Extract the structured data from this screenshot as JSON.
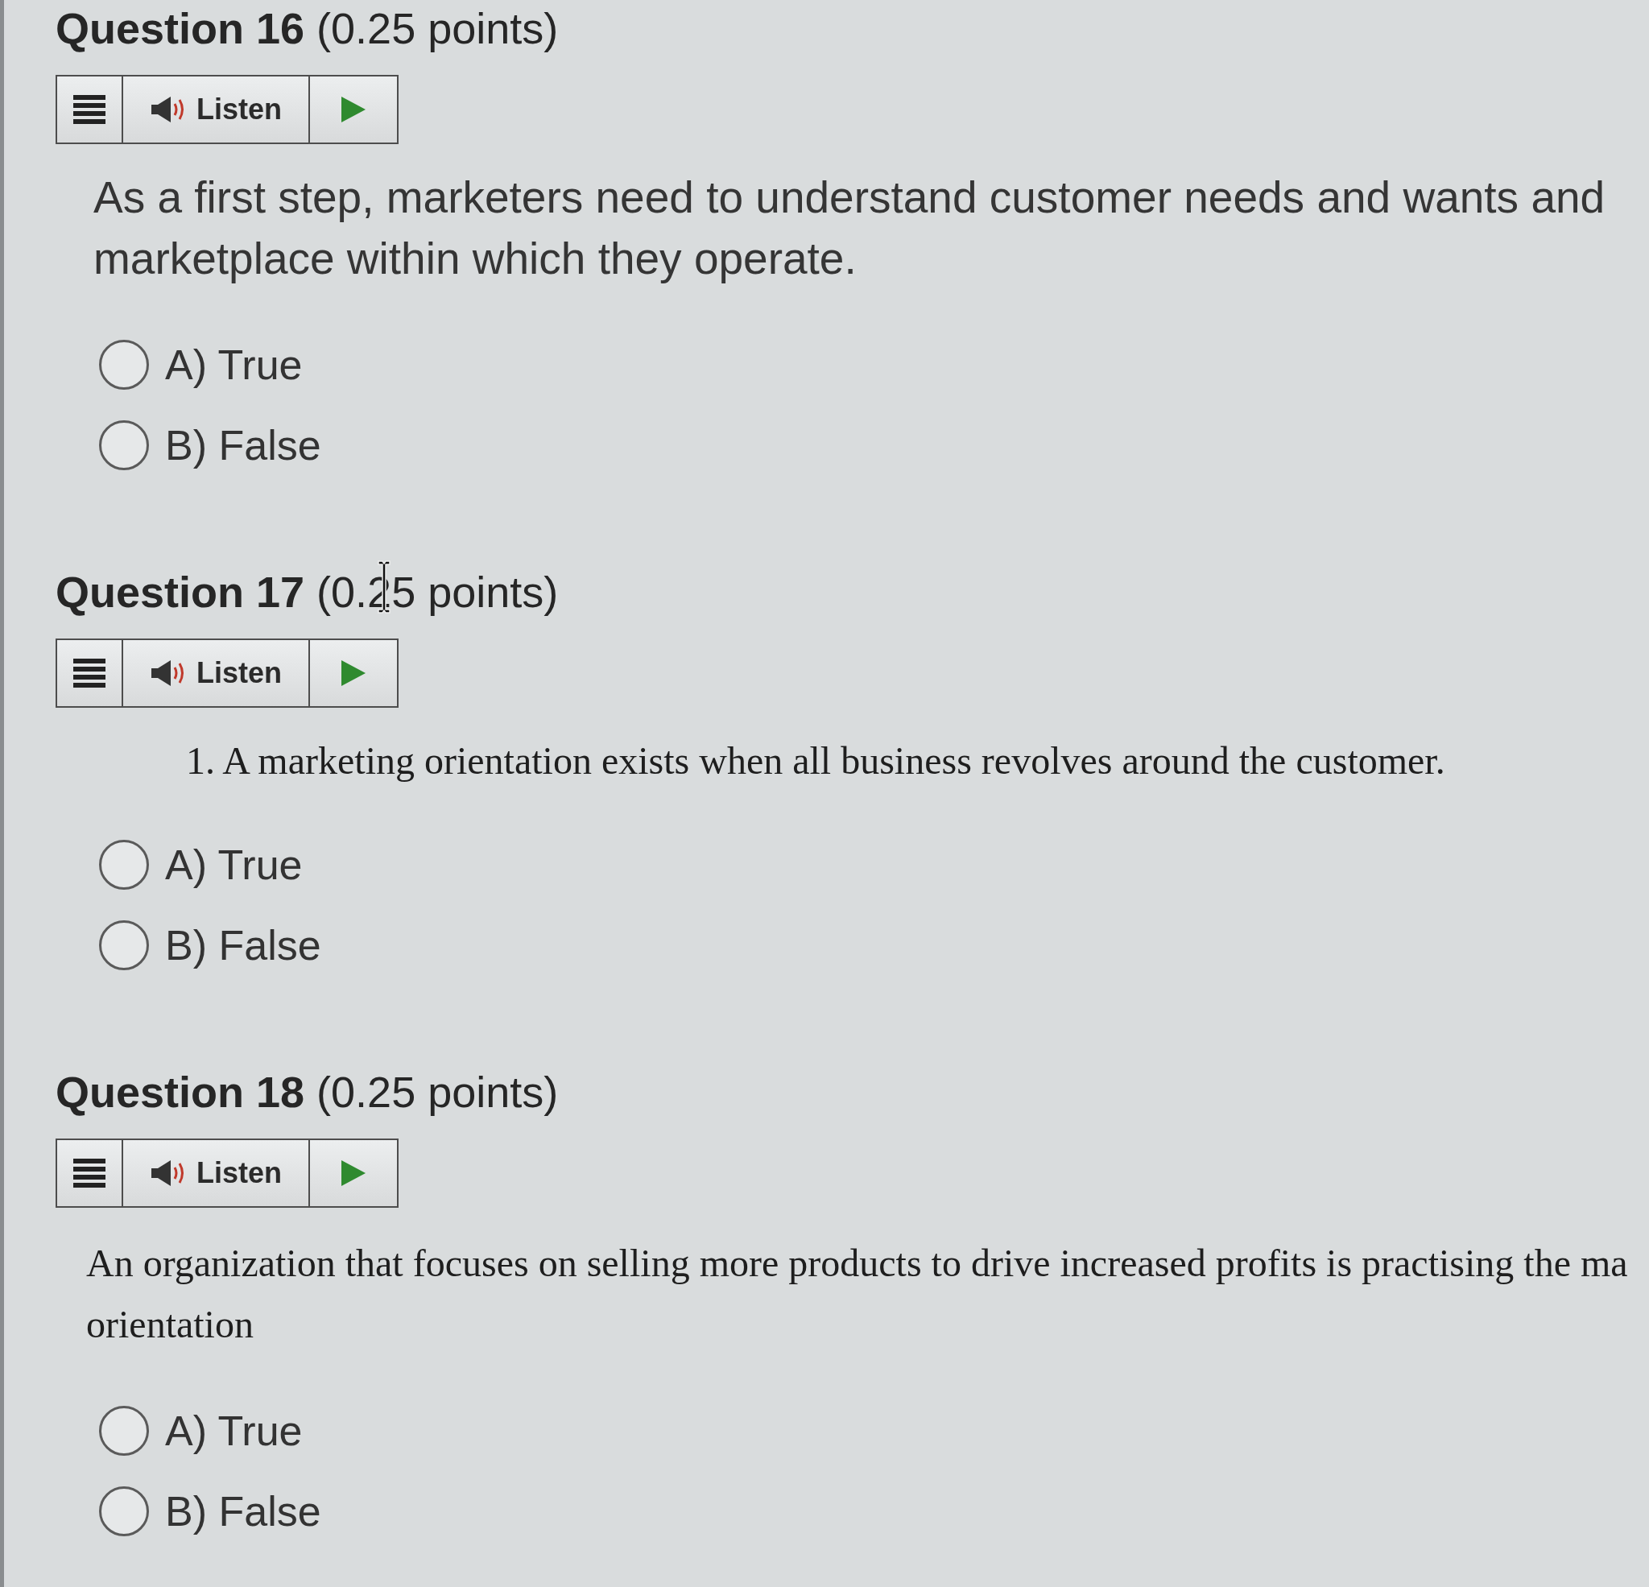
{
  "questions": [
    {
      "title": "**Question 16** (0.25 points)",
      "toolbar": {
        "listen": "Listen"
      },
      "prompt": {
        "kind": "sans",
        "lines": [
          "As a first step, marketers need to understand customer needs and wants and",
          "marketplace within which they operate."
        ]
      },
      "options": [
        {
          "label": "A) True",
          "selected": false
        },
        {
          "label": "B) False",
          "selected": false
        }
      ]
    },
    {
      "title": "**Question 17** (0.25 points)",
      "text_cursor": true,
      "toolbar": {
        "listen": "Listen"
      },
      "prompt": {
        "kind": "list",
        "lines": [
          "1. A marketing orientation exists when all business revolves around the customer."
        ]
      },
      "options": [
        {
          "label": "A) True",
          "selected": false
        },
        {
          "label": "B) False",
          "selected": false
        }
      ]
    },
    {
      "title": "**Question 18** (0.25 points)",
      "toolbar": {
        "listen": "Listen"
      },
      "prompt": {
        "kind": "serif",
        "lines": [
          "An organization that focuses on selling more products to drive increased profits is practising the ma",
          "orientation"
        ]
      },
      "options": [
        {
          "label": "A) True",
          "selected": false
        },
        {
          "label": "B) False",
          "selected": false
        }
      ]
    }
  ]
}
